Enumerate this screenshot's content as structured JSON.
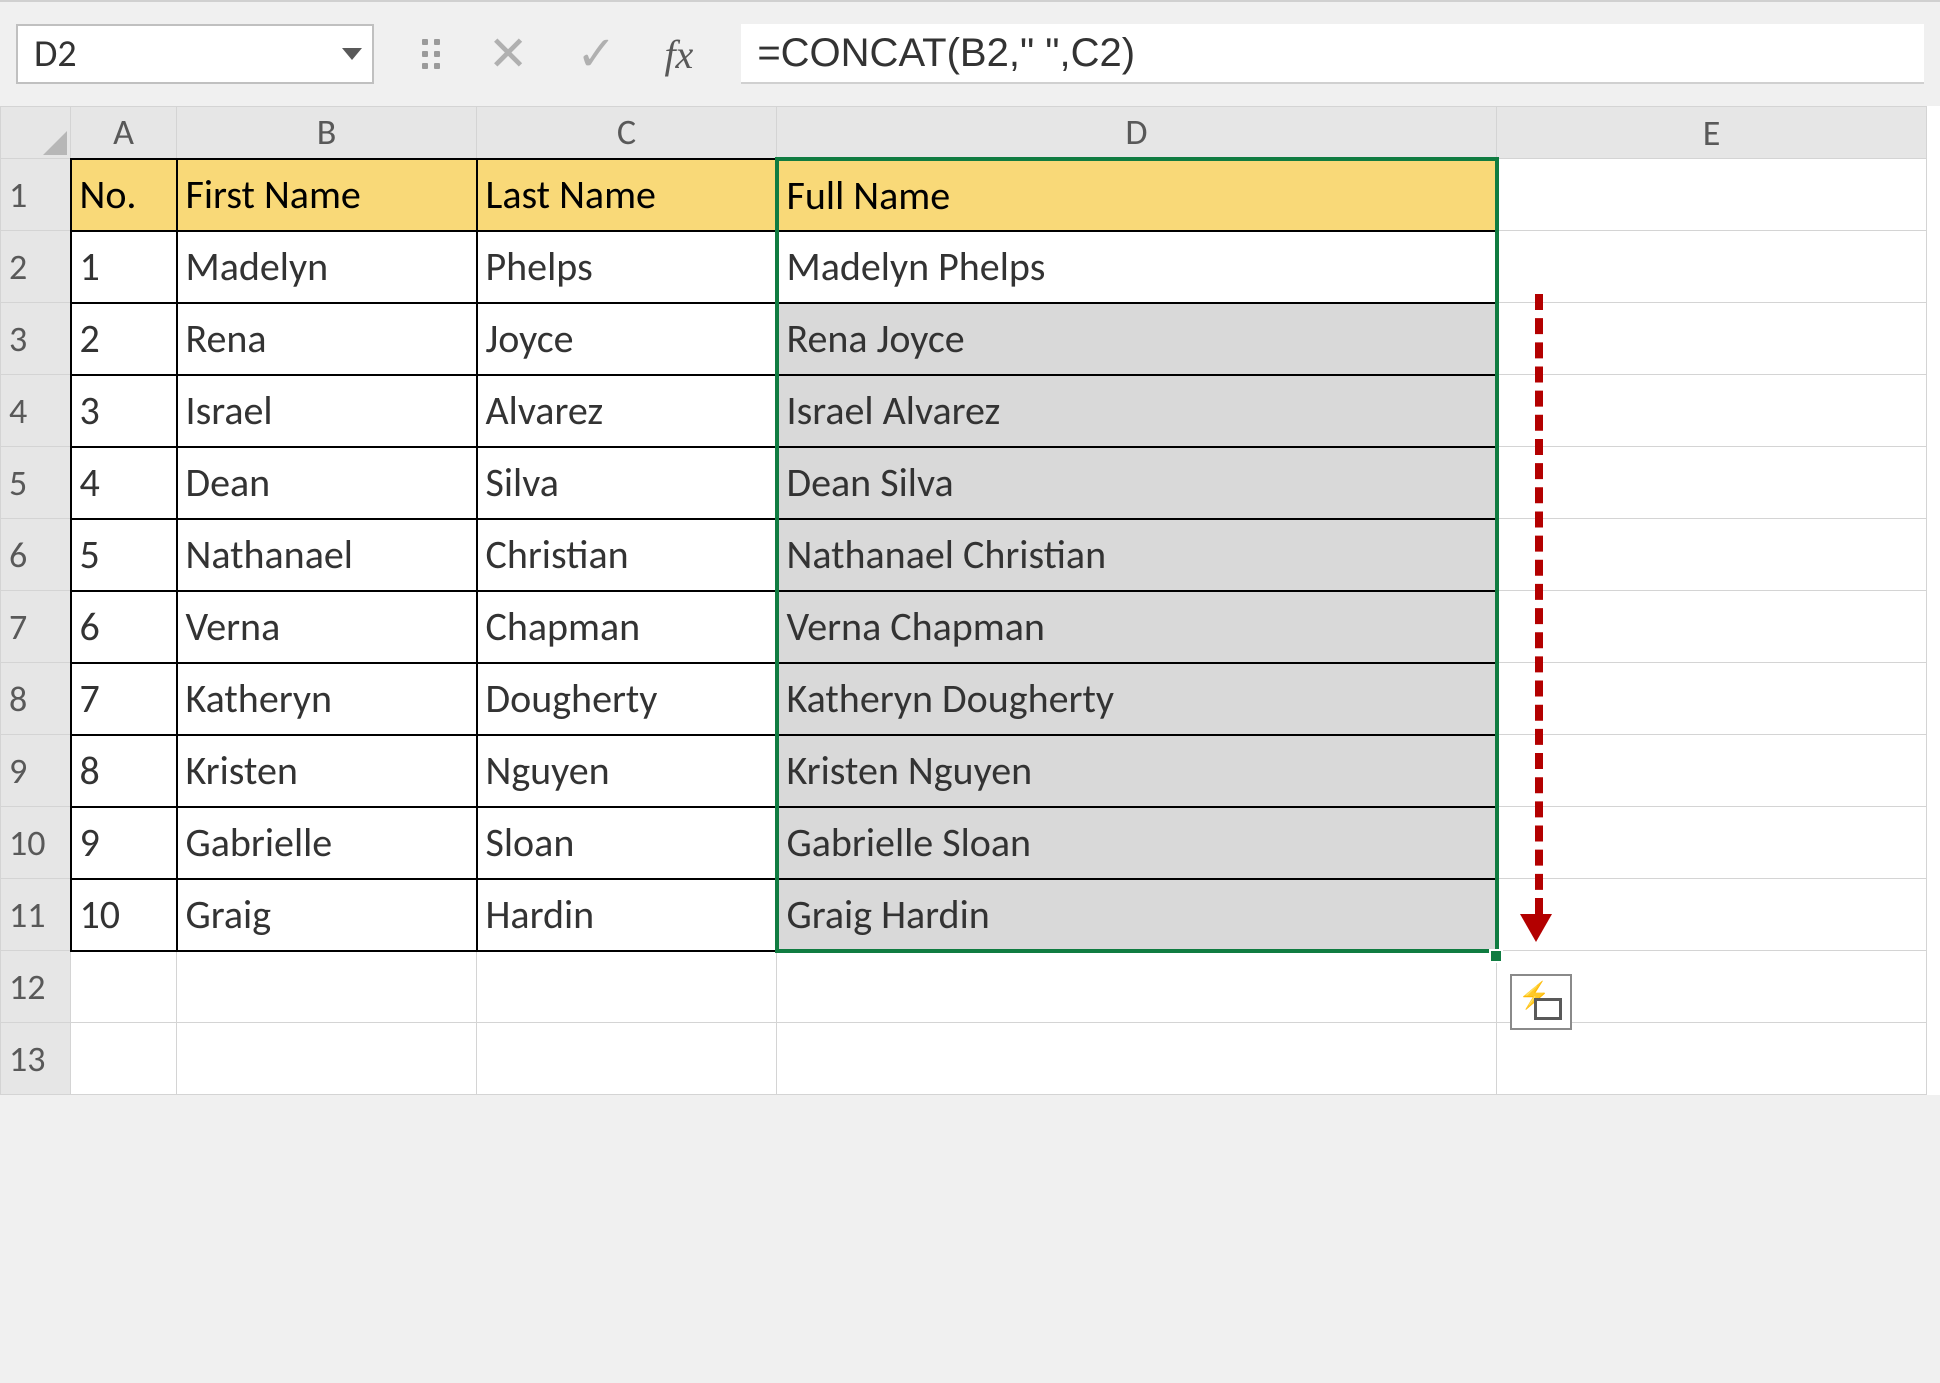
{
  "formula_bar": {
    "cell_ref": "D2",
    "fx_label": "fx",
    "formula": "=CONCAT(B2,\" \",C2)"
  },
  "columns": [
    "A",
    "B",
    "C",
    "D",
    "E"
  ],
  "row_headers": [
    "1",
    "2",
    "3",
    "4",
    "5",
    "6",
    "7",
    "8",
    "9",
    "10",
    "11",
    "12",
    "13"
  ],
  "headers": {
    "A": "No.",
    "B": "First Name",
    "C": "Last Name",
    "D": "Full Name"
  },
  "rows": [
    {
      "no": "1",
      "first": "Madelyn",
      "last": "Phelps",
      "full": "Madelyn Phelps"
    },
    {
      "no": "2",
      "first": "Rena",
      "last": "Joyce",
      "full": "Rena Joyce"
    },
    {
      "no": "3",
      "first": "Israel",
      "last": "Alvarez",
      "full": "Israel Alvarez"
    },
    {
      "no": "4",
      "first": "Dean",
      "last": "Silva",
      "full": "Dean Silva"
    },
    {
      "no": "5",
      "first": "Nathanael",
      "last": "Christian",
      "full": "Nathanael Christian"
    },
    {
      "no": "6",
      "first": "Verna",
      "last": "Chapman",
      "full": "Verna Chapman"
    },
    {
      "no": "7",
      "first": "Katheryn",
      "last": "Dougherty",
      "full": "Katheryn Dougherty"
    },
    {
      "no": "8",
      "first": "Kristen",
      "last": "Nguyen",
      "full": "Kristen Nguyen"
    },
    {
      "no": "9",
      "first": "Gabrielle",
      "last": "Sloan",
      "full": "Gabrielle Sloan"
    },
    {
      "no": "10",
      "first": "Graig",
      "last": "Hardin",
      "full": "Graig Hardin"
    }
  ],
  "selection": {
    "active_cell": "D2",
    "range": "D2:D11"
  },
  "colors": {
    "selection_border": "#107c41",
    "header_fill": "#f9d978",
    "annotation_arrow": "#b30000"
  }
}
